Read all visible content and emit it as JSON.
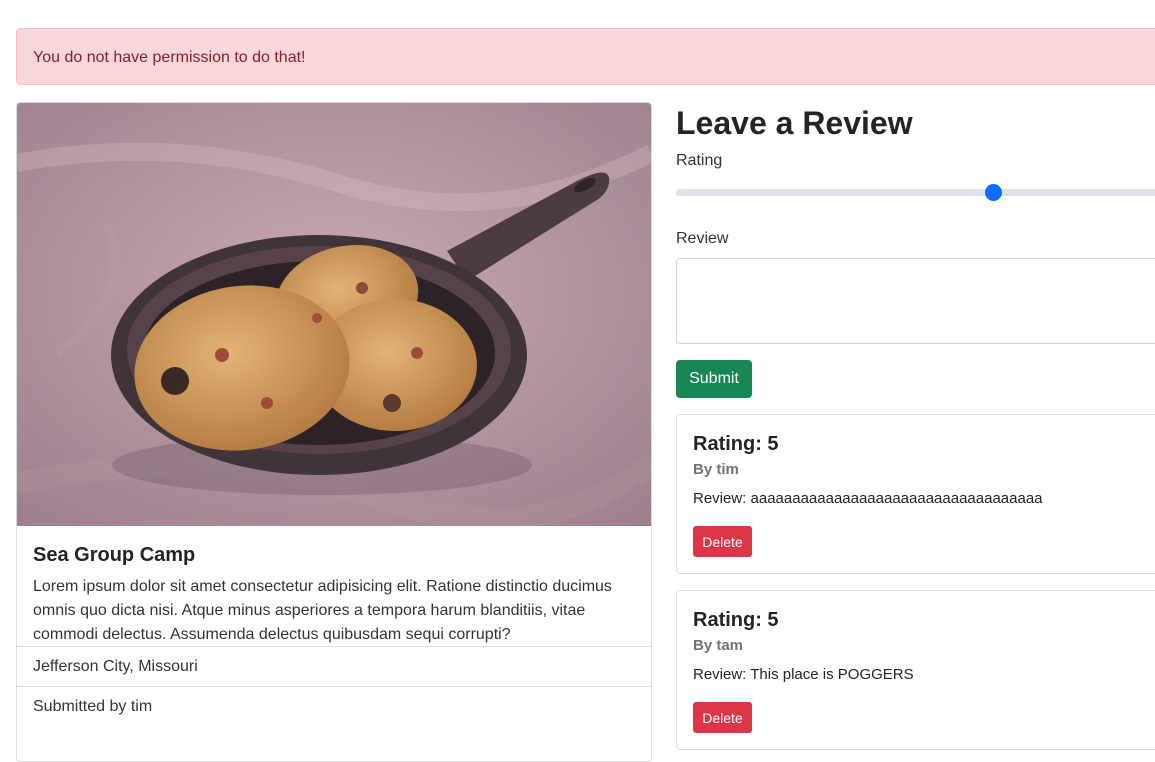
{
  "alert": {
    "message": "You do not have permission to do that!"
  },
  "campground": {
    "image_alt": "Cookies in a cast iron skillet",
    "title": "Sea Group Camp",
    "description": "Lorem ipsum dolor sit amet consectetur adipisicing elit. Ratione distinctio ducimus omnis quo dicta nisi. Atque minus asperiores a tempora harum blanditiis, vitae commodi delectus. Assumenda delectus quibusdam sequi corrupti?",
    "location": "Jefferson City, Missouri",
    "submitted_by": "Submitted by tim"
  },
  "review_form": {
    "heading": "Leave a Review",
    "rating_label": "Rating",
    "rating_value": 3,
    "rating_range": [
      1,
      5
    ],
    "review_label": "Review",
    "review_value": "",
    "submit_label": "Submit"
  },
  "reviews": [
    {
      "title": "Rating: 5",
      "author": "By tim",
      "text": "Review: aaaaaaaaaaaaaaaaaaaaaaaaaaaaaaaaaaa",
      "delete_label": "Delete"
    },
    {
      "title": "Rating: 5",
      "author": "By tam",
      "text": "Review: This place is POGGERS",
      "delete_label": "Delete"
    }
  ],
  "colors": {
    "alert_bg": "#f8d7da",
    "alert_text": "#842029",
    "submit_button": "#198754",
    "delete_button": "#dc3545",
    "slider_thumb": "#0d6efd"
  }
}
